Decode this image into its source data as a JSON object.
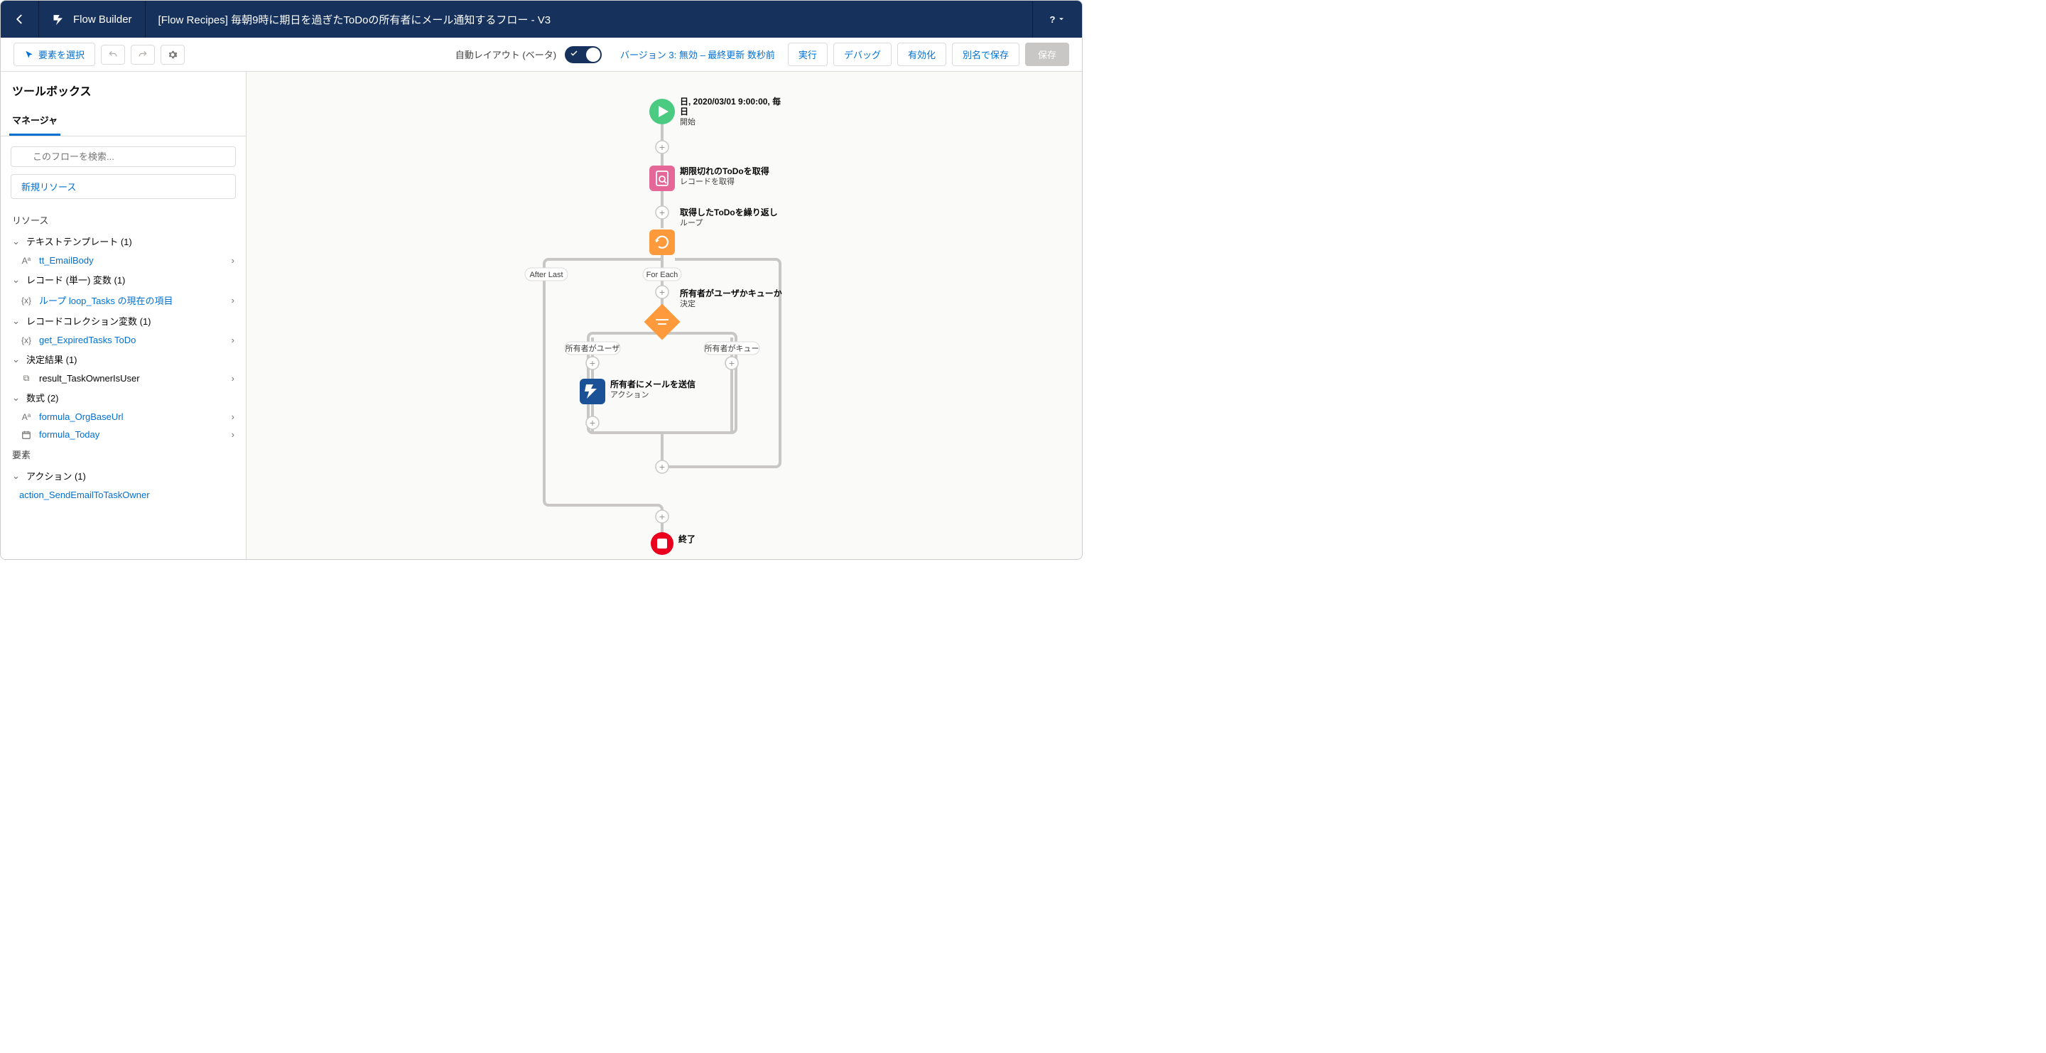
{
  "header": {
    "app_name": "Flow Builder",
    "title": "[Flow Recipes] 毎朝9時に期日を過ぎたToDoの所有者にメール通知するフロー - V3",
    "help": "?"
  },
  "toolbar": {
    "select_element": "要素を選択",
    "auto_layout": "自動レイアウト (ベータ)",
    "version": "バージョン 3: 無効 – 最終更新 数秒前",
    "run": "実行",
    "debug": "デバッグ",
    "activate": "有効化",
    "save_as": "別名で保存",
    "save": "保存"
  },
  "sidebar": {
    "title": "ツールボックス",
    "tab": "マネージャ",
    "search_placeholder": "このフローを検索...",
    "new_resource": "新規リソース",
    "section_resources": "リソース",
    "section_elements": "要素",
    "groups": {
      "text_template": "テキストテンプレート (1)",
      "record_single": "レコード (単一) 変数 (1)",
      "record_collection": "レコードコレクション変数 (1)",
      "decision_result": "決定結果 (1)",
      "formula": "数式 (2)",
      "action": "アクション (1)"
    },
    "items": {
      "tt_emailbody": "tt_EmailBody",
      "loop_current": "ループ loop_Tasks の現在の項目",
      "get_expired": "get_ExpiredTasks ToDo",
      "result_owner": "result_TaskOwnerIsUser",
      "formula_baseurl": "formula_OrgBaseUrl",
      "formula_today": "formula_Today",
      "action_sendemail": "action_SendEmailToTaskOwner"
    }
  },
  "canvas": {
    "start_line1": "日, 2020/03/01 9:00:00, 毎",
    "start_line2": "日",
    "start_sub": "開始",
    "get_title": "期限切れのToDoを取得",
    "get_sub": "レコードを取得",
    "loop_title": "取得したToDoを繰り返し",
    "loop_sub": "ループ",
    "loop_after": "After Last",
    "loop_each": "For Each",
    "dec_title": "所有者がユーザかキューか",
    "dec_sub": "決定",
    "dec_left": "所有者がユーザ",
    "dec_right": "所有者がキュー",
    "action_title": "所有者にメールを送信",
    "action_sub": "アクション",
    "end": "終了"
  }
}
